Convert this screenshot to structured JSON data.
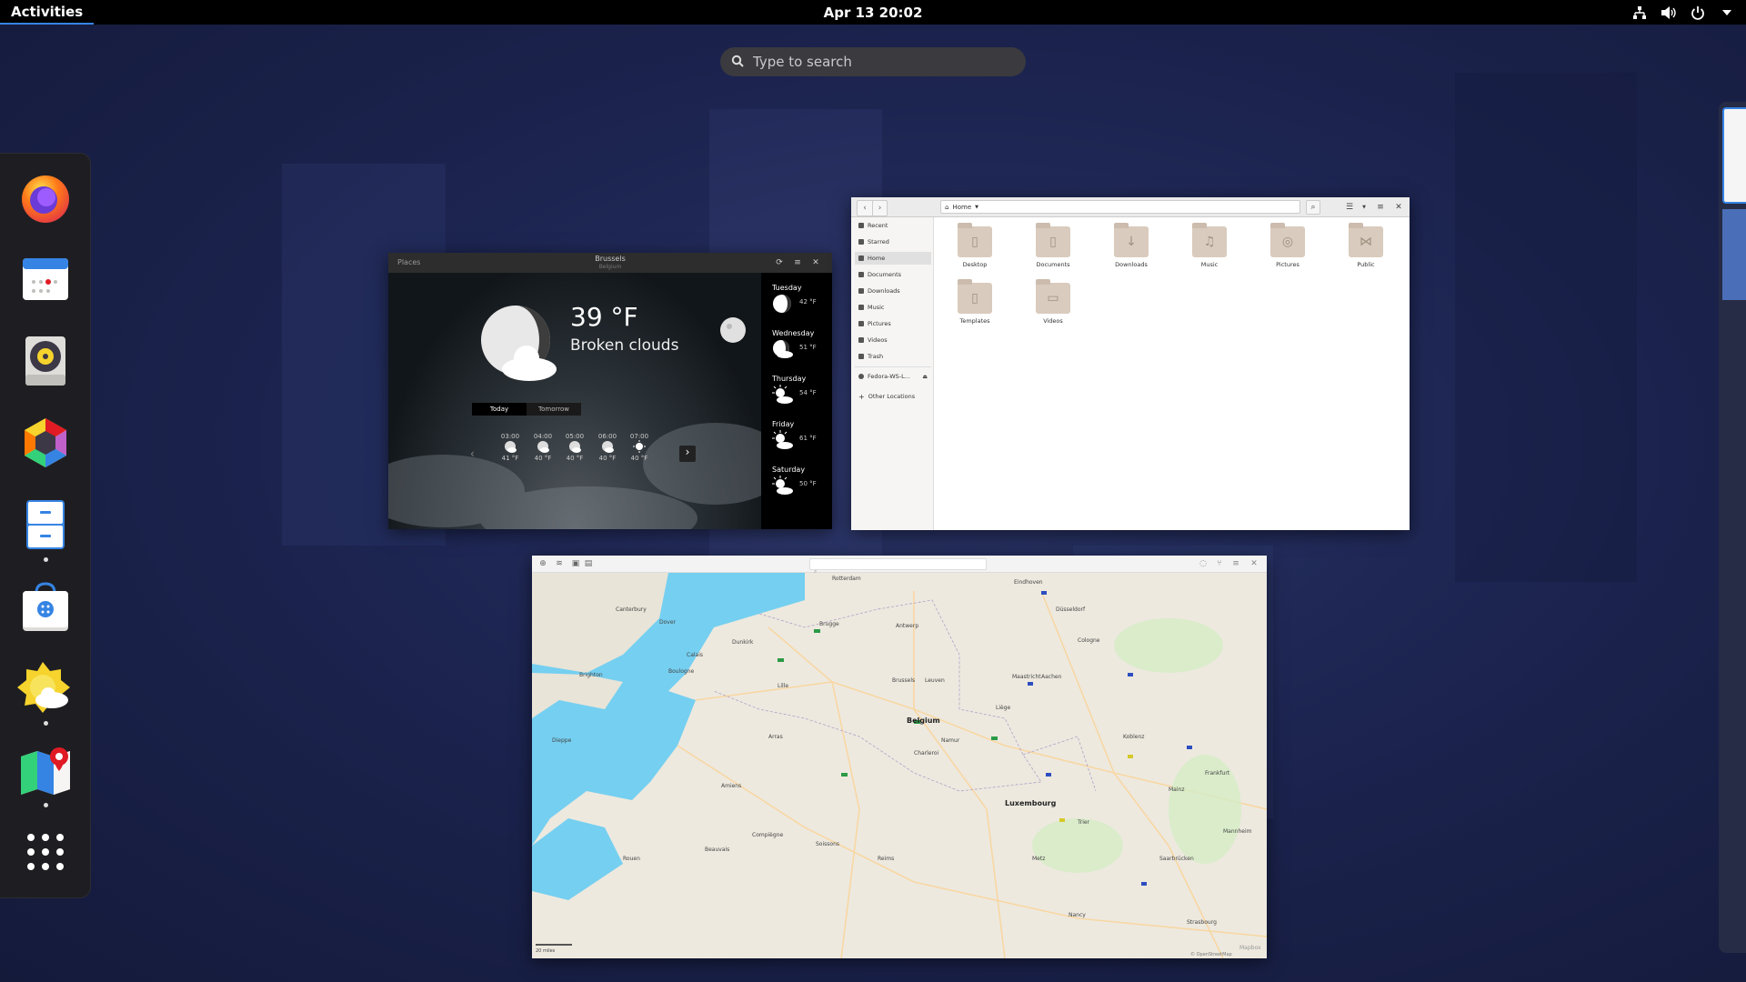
{
  "topbar": {
    "activities": "Activities",
    "clock": "Apr 13  20:02",
    "icons": [
      "network-icon",
      "volume-icon",
      "power-icon",
      "chevron-down-icon"
    ]
  },
  "search": {
    "placeholder": "Type to search"
  },
  "dash": {
    "apps": [
      {
        "name": "Firefox",
        "icon": "firefox-icon",
        "running": false
      },
      {
        "name": "Calendar",
        "icon": "calendar-icon",
        "running": false
      },
      {
        "name": "Rhythmbox",
        "icon": "rhythmbox-icon",
        "running": false
      },
      {
        "name": "Photos",
        "icon": "photos-icon",
        "running": false
      },
      {
        "name": "Files",
        "icon": "files-icon",
        "running": true
      },
      {
        "name": "Software",
        "icon": "software-icon",
        "running": false
      },
      {
        "name": "Weather",
        "icon": "weather-icon",
        "running": true
      },
      {
        "name": "Maps",
        "icon": "maps-icon",
        "running": true
      },
      {
        "name": "Show Applications",
        "icon": "app-grid-icon",
        "running": false
      }
    ]
  },
  "weather": {
    "header_left": "Places",
    "city": "Brussels",
    "country": "Belgium",
    "temperature": "39 °F",
    "condition": "Broken clouds",
    "tabs": [
      "Today",
      "Tomorrow"
    ],
    "hours": [
      {
        "time": "03:00",
        "temp": "41 °F"
      },
      {
        "time": "04:00",
        "temp": "40 °F"
      },
      {
        "time": "05:00",
        "temp": "40 °F"
      },
      {
        "time": "06:00",
        "temp": "40 °F"
      },
      {
        "time": "07:00",
        "temp": "40 °F"
      }
    ],
    "days": [
      {
        "day": "Tuesday",
        "temp": "42 °F"
      },
      {
        "day": "Wednesday",
        "temp": "51 °F"
      },
      {
        "day": "Thursday",
        "temp": "54 °F"
      },
      {
        "day": "Friday",
        "temp": "61 °F"
      },
      {
        "day": "Saturday",
        "temp": "50 °F"
      }
    ]
  },
  "files": {
    "path": "Home",
    "sidebar": [
      "Recent",
      "Starred",
      "Home",
      "Documents",
      "Downloads",
      "Music",
      "Pictures",
      "Videos",
      "Trash",
      "Fedora-WS-L...",
      "Other Locations"
    ],
    "folders": [
      "Desktop",
      "Documents",
      "Downloads",
      "Music",
      "Pictures",
      "Public",
      "Templates",
      "Videos"
    ]
  },
  "maps": {
    "big_labels": [
      "Belgium",
      "Luxembourg"
    ],
    "cities": [
      "Brugge",
      "Antwerp",
      "Brussels",
      "Leuven",
      "Liège",
      "Lille",
      "Calais",
      "Dunkirk",
      "Namur",
      "Charleroi",
      "Cologne",
      "Düsseldorf",
      "Aachen",
      "Koblenz",
      "Frankfurt",
      "Mainz",
      "Trier",
      "Metz",
      "Reims",
      "Amiens",
      "Rouen",
      "Boulogne",
      "Dover",
      "Canterbury",
      "Brighton",
      "Maastricht",
      "Eindhoven",
      "Rotterdam",
      "Saarbrücken",
      "Mannheim",
      "Strasbourg",
      "Nancy",
      "Beauvais",
      "Compiègne",
      "Soissons",
      "Arras",
      "Dieppe"
    ],
    "attribution": "© OpenStreetMap",
    "brand": "Mapbox",
    "scale": "20 miles"
  }
}
